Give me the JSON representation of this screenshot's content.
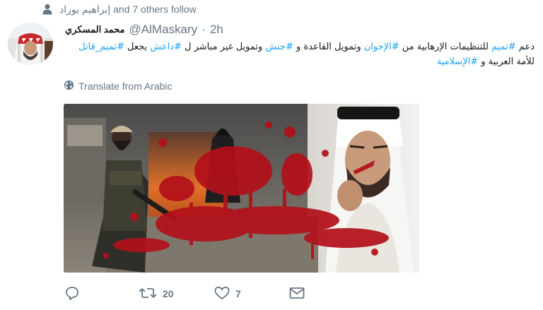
{
  "social_context": {
    "text": "إبراهيم بوراد and 7 others follow",
    "icon": "person-icon"
  },
  "tweet": {
    "author_name": "محمد المسكري",
    "handle": "@AlMaskary",
    "separator": "·",
    "time": "2h",
    "text_parts": [
      {
        "t": "دعم ",
        "tag": false
      },
      {
        "t": "#تميم",
        "tag": true
      },
      {
        "t": " للتنظيمات الإرهابية من ",
        "tag": false
      },
      {
        "t": "#الإخوان",
        "tag": true
      },
      {
        "t": " وتمويل القاعدة و ",
        "tag": false
      },
      {
        "t": "#جنش",
        "tag": true
      },
      {
        "t": " وتمويل غير مباشر ل ",
        "tag": false
      },
      {
        "t": "#داعش",
        "tag": true
      },
      {
        "t": " يجعل ",
        "tag": false
      },
      {
        "t": "#تميم_قاتل",
        "tag": true
      },
      {
        "t": " للأمة العربية و ",
        "tag": false
      },
      {
        "t": "#الإسلامية",
        "tag": true
      }
    ],
    "translate_label": "Translate from Arabic",
    "colors": {
      "link": "#1da1f2",
      "muted": "#657786",
      "text": "#14171a",
      "blood": "#b3101a"
    }
  },
  "actions": {
    "reply_count": "",
    "retweet_count": "20",
    "like_count": "7",
    "icons": [
      "reply-icon",
      "retweet-icon",
      "like-icon",
      "direct-message-icon"
    ]
  }
}
